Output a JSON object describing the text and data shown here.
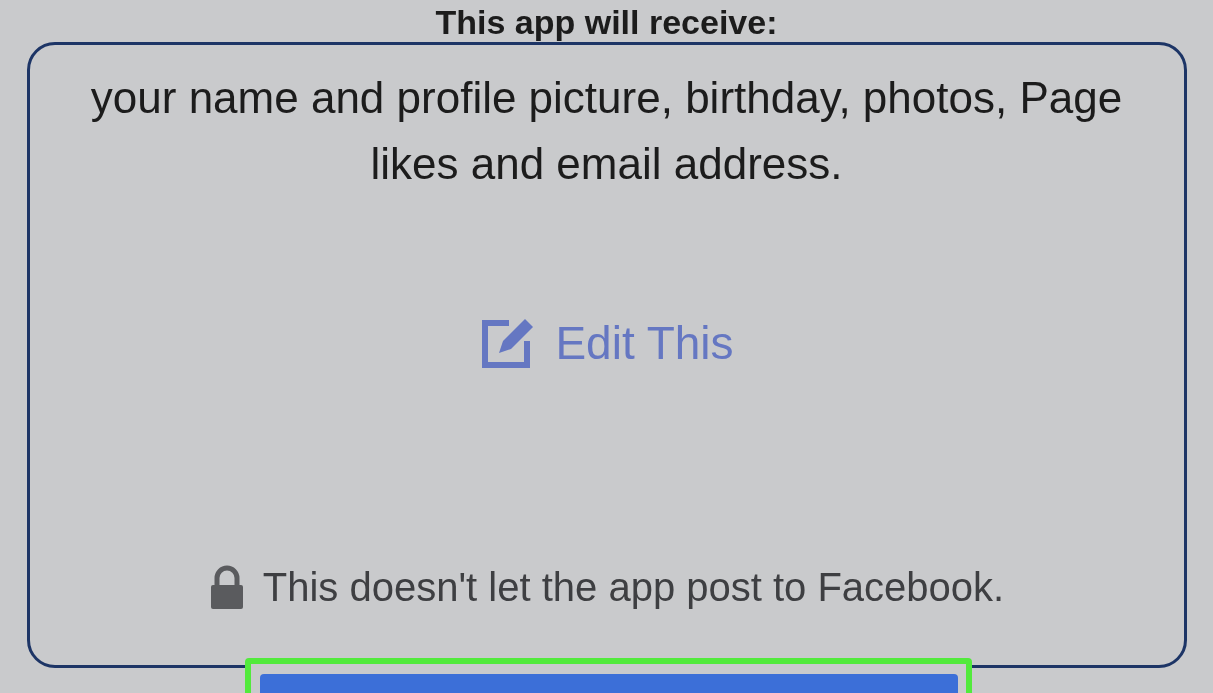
{
  "heading": "This app will receive:",
  "permissions_text": "your name and profile picture, birthday, photos, Page likes and email address.",
  "edit_link": {
    "label": "Edit This"
  },
  "notice": "This doesn't let the app post to Facebook."
}
